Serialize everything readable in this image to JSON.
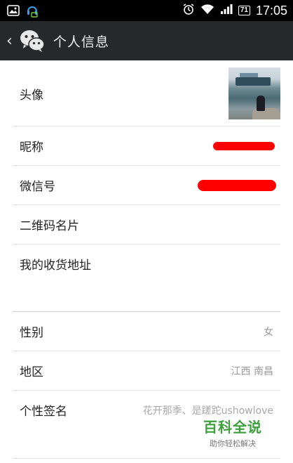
{
  "status_bar": {
    "time": "17:05",
    "battery": "71",
    "icons": [
      "image-icon",
      "headset-icon",
      "alarm-icon",
      "wifi-icon",
      "signal-icon",
      "battery-icon"
    ]
  },
  "header": {
    "back": "‹",
    "title": "个人信息",
    "logo": "wechat-icon"
  },
  "rows": [
    {
      "label": "头像",
      "value": ""
    },
    {
      "label": "昵称",
      "value": ""
    },
    {
      "label": "微信号",
      "value": ""
    },
    {
      "label": "二维码名片",
      "value": ""
    },
    {
      "label": "我的收货地址",
      "value": ""
    },
    {
      "label": "性别",
      "value": "女"
    },
    {
      "label": "地区",
      "value": "江西 南昌"
    },
    {
      "label": "个性签名",
      "value": "花开那季、是蹉跎ushowlove"
    }
  ],
  "watermark": {
    "title": "百科全说",
    "subtitle": "助你轻松解决"
  },
  "colors": {
    "header_bg": "#262829",
    "redaction": "#ff0000",
    "watermark_green": "#3ca03c"
  }
}
